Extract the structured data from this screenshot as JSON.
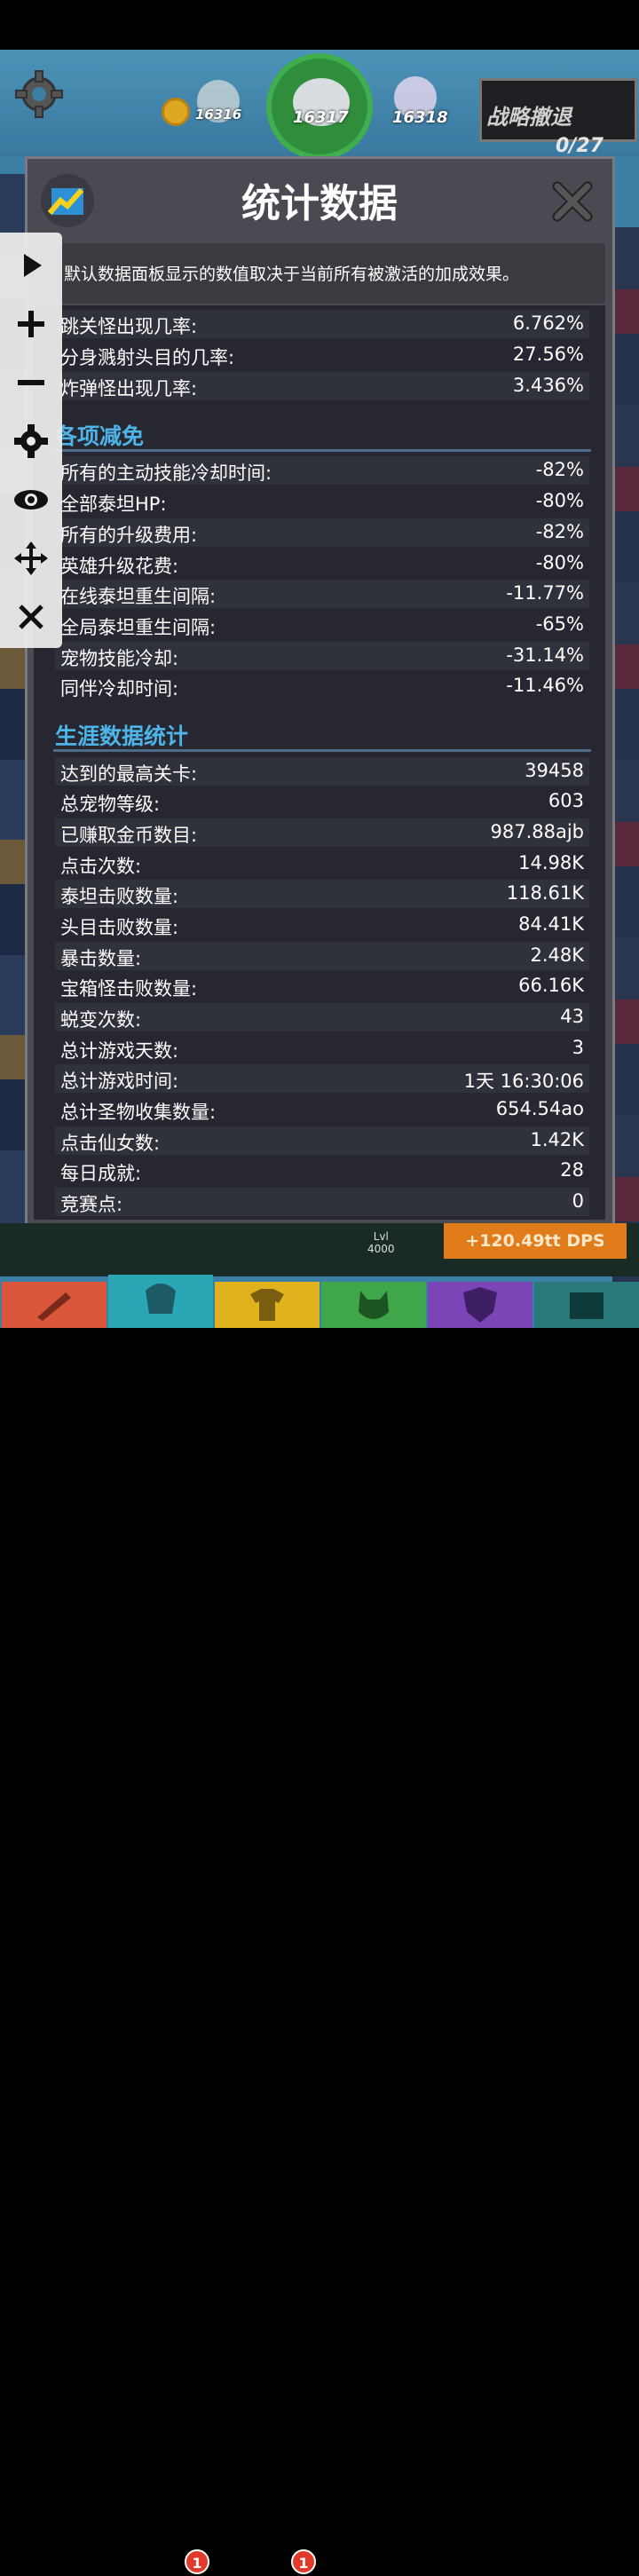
{
  "hud": {
    "stage_prev": "16316",
    "stage_current": "16317",
    "stage_next": "16318",
    "retreat_label": "战略撤退",
    "retreat_count": "0/27"
  },
  "panel": {
    "title": "统计数据",
    "info": "默认数据面板显示的数值取决于当前所有被激活的加成效果。"
  },
  "top_stats": [
    {
      "label": "跳关怪出现几率:",
      "value": "6.762%"
    },
    {
      "label": "分身溅射头目的几率:",
      "value": "27.56%"
    },
    {
      "label": "炸弹怪出现几率:",
      "value": "3.436%"
    }
  ],
  "reductions": {
    "heading": "各项减免",
    "rows": [
      {
        "label": "所有的主动技能冷却时间:",
        "value": "-82%"
      },
      {
        "label": "全部泰坦HP:",
        "value": "-80%"
      },
      {
        "label": "所有的升级费用:",
        "value": "-82%"
      },
      {
        "label": "英雄升级花费:",
        "value": "-80%"
      },
      {
        "label": "在线泰坦重生间隔:",
        "value": "-11.77%"
      },
      {
        "label": "全局泰坦重生间隔:",
        "value": "-65%"
      },
      {
        "label": "宠物技能冷却:",
        "value": "-31.14%"
      },
      {
        "label": "同伴冷却时间:",
        "value": "-11.46%"
      }
    ]
  },
  "career": {
    "heading": "生涯数据统计",
    "rows": [
      {
        "label": "达到的最高关卡:",
        "value": "39458"
      },
      {
        "label": "总宠物等级:",
        "value": "603"
      },
      {
        "label": "已赚取金币数目:",
        "value": "987.88ajb"
      },
      {
        "label": "点击次数:",
        "value": "14.98K"
      },
      {
        "label": "泰坦击败数量:",
        "value": "118.61K"
      },
      {
        "label": "头目击败数量:",
        "value": "84.41K"
      },
      {
        "label": "暴击数量:",
        "value": "2.48K"
      },
      {
        "label": "宝箱怪击败数量:",
        "value": "66.16K"
      },
      {
        "label": "蜕变次数:",
        "value": "43"
      },
      {
        "label": "总计游戏天数:",
        "value": "3"
      },
      {
        "label": "总计游戏时间:",
        "value": "1天 16:30:06"
      },
      {
        "label": "总计圣物收集数量:",
        "value": "654.54ao"
      },
      {
        "label": "点击仙女数:",
        "value": "1.42K"
      },
      {
        "label": "每日成就:",
        "value": "28"
      },
      {
        "label": "竞赛点:",
        "value": "0"
      }
    ]
  },
  "bottom": {
    "lvl_label": "Lvl",
    "lvl_value": "4000",
    "dps": "+120.49tt DPS",
    "tabs": [
      {
        "name": "sword",
        "color": "#d9563a",
        "badge": ""
      },
      {
        "name": "heroes",
        "color": "#2aa6b5",
        "badge": "1"
      },
      {
        "name": "equipment",
        "color": "#e0b21e",
        "badge": "1"
      },
      {
        "name": "pets",
        "color": "#3fa64a",
        "badge": ""
      },
      {
        "name": "clan",
        "color": "#7b45b8",
        "badge": ""
      },
      {
        "name": "shop",
        "color": "#2a7a7a",
        "badge": ""
      }
    ]
  },
  "colors": {
    "section_heading": "#4eb3e6",
    "panel_bg": "#4a4a52",
    "list_bg": "#262730"
  }
}
